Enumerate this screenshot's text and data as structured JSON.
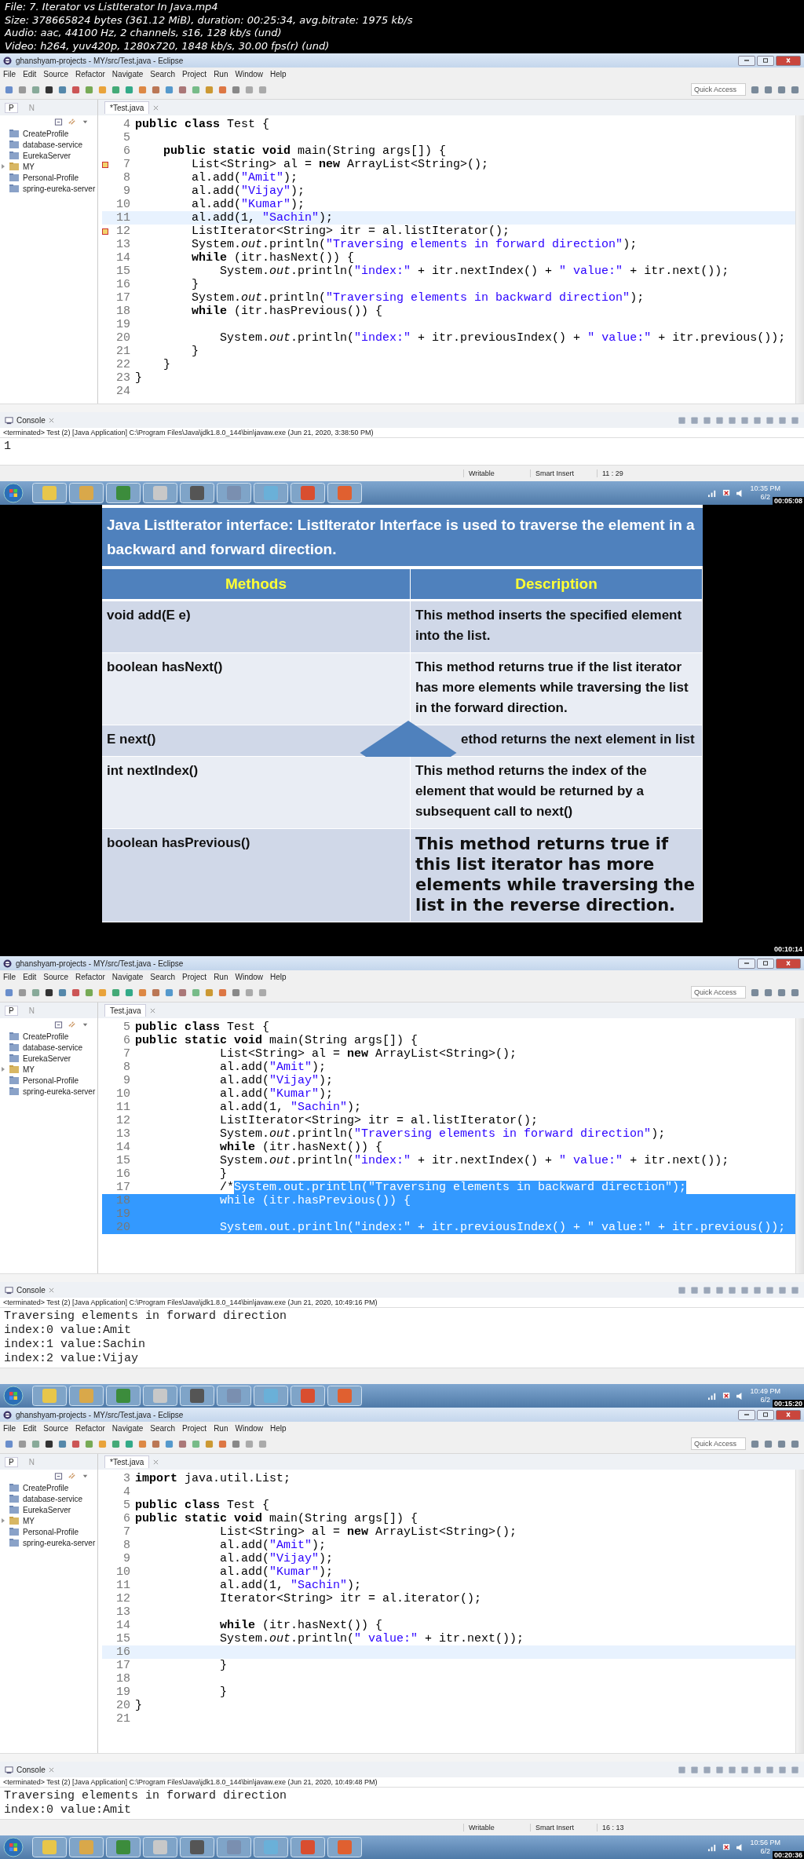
{
  "info": [
    "File: 7. Iterator vs ListIterator In Java.mp4",
    "Size: 378665824 bytes (361.12 MiB), duration: 00:25:34, avg.bitrate: 1975 kb/s",
    "Audio: aac, 44100 Hz, 2 channels, s16, 128 kb/s (und)",
    "Video: h264, yuv420p, 1280x720, 1848 kb/s, 30.00 fps(r) (und)"
  ],
  "frames": [
    {
      "kind": "ide",
      "title": "ghanshyam-projects - MY/src/Test.java - Eclipse",
      "menu": [
        "File",
        "Edit",
        "Source",
        "Refactor",
        "Navigate",
        "Search",
        "Project",
        "Run",
        "Window",
        "Help"
      ],
      "quick_access": "Quick Access",
      "left_tabs": [
        {
          "label": "P",
          "selected": true
        },
        {
          "label": "N",
          "selected": false
        }
      ],
      "tree": [
        {
          "label": "CreateProfile",
          "kind": "folder"
        },
        {
          "label": "database-service",
          "kind": "folder"
        },
        {
          "label": "EurekaServer",
          "kind": "folder"
        },
        {
          "label": "MY",
          "kind": "project"
        },
        {
          "label": "Personal-Profile",
          "kind": "folder"
        },
        {
          "label": "spring-eureka-server",
          "kind": "folder"
        }
      ],
      "editor_tab": "*Test.java",
      "code": [
        {
          "num": "4",
          "kind": "plain",
          "text": "**public** **class** Test {"
        },
        {
          "num": "5",
          "kind": "plain"
        },
        {
          "num": "6",
          "kind": "plain",
          "text": "    **public** **static** **void** main(String args[]) {"
        },
        {
          "num": "7",
          "kind": "marked",
          "text": "        List<String> al = **new** ArrayList<String>();"
        },
        {
          "num": "8",
          "kind": "plain",
          "text": "        al.add(\"Amit\");"
        },
        {
          "num": "9",
          "kind": "plain",
          "text": "        al.add(\"Vijay\");"
        },
        {
          "num": "10",
          "kind": "plain",
          "text": "        al.add(\"Kumar\");"
        },
        {
          "num": "11",
          "kind": "current",
          "text": "        al.add(1, \"Sachin\");"
        },
        {
          "num": "12",
          "kind": "marked",
          "text": "        ListIterator<String> itr = al.listIterator();"
        },
        {
          "num": "13",
          "kind": "plain",
          "text": "        System.*out*.println(\"Traversing elements in forward direction\");"
        },
        {
          "num": "14",
          "kind": "plain",
          "text": "        **while** (itr.hasNext()) {"
        },
        {
          "num": "15",
          "kind": "plain",
          "text": "            System.*out*.println(\"index:\" + itr.nextIndex() + \" value:\" + itr.next());"
        },
        {
          "num": "16",
          "kind": "plain",
          "text": "        }"
        },
        {
          "num": "17",
          "kind": "plain",
          "text": "        System.*out*.println(\"Traversing elements in backward direction\");"
        },
        {
          "num": "18",
          "kind": "plain",
          "text": "        **while** (itr.hasPrevious()) {"
        },
        {
          "num": "19",
          "kind": "plain"
        },
        {
          "num": "20",
          "kind": "plain",
          "text": "            System.*out*.println(\"index:\" + itr.previousIndex() + \" value:\" + itr.previous());"
        },
        {
          "num": "21",
          "kind": "plain",
          "text": "        }"
        },
        {
          "num": "22",
          "kind": "plain",
          "text": "    }"
        },
        {
          "num": "23",
          "kind": "plain",
          "text": "}"
        },
        {
          "num": "24",
          "kind": "plain"
        }
      ],
      "console": {
        "label": "Console",
        "status": "<terminated> Test (2) [Java Application] C:\\Program Files\\Java\\jdk1.8.0_144\\bin\\javaw.exe (Jun 21, 2020, 3:38:50 PM)",
        "output": [
          "1"
        ]
      },
      "status": [
        "Writable",
        "Smart Insert",
        "11 : 29"
      ],
      "taskbar": {
        "clock": "10:35 PM",
        "date": "6/2",
        "timestamp": "00:05:08"
      }
    },
    {
      "kind": "slide",
      "heading": "**Java ListIterator interface**: ListIterator Interface is used to traverse the element in a backward and forward direction.",
      "columns": [
        "Methods",
        "Description"
      ],
      "rows": [
        {
          "method": "void add(E e)",
          "description": "This method inserts the specified element into the list.",
          "kind": "normal"
        },
        {
          "method": "boolean hasNext()",
          "description": "This method returns true if the list iterator has more elements while traversing the list in the forward direction.",
          "kind": "normal"
        },
        {
          "method": "E next()",
          "description": "ethod returns the next element in list",
          "kind": "pointer"
        },
        {
          "method": "int nextIndex()",
          "description": "This method returns the index of the element that would be returned by a subsequent call to next()",
          "kind": "normal"
        },
        {
          "method": "boolean hasPrevious()",
          "description": "This method returns true if this list iterator has more elements while traversing the list in the reverse direction.",
          "kind": "emphasis"
        }
      ],
      "timestamp": "00:10:14"
    },
    {
      "kind": "ide",
      "title": "ghanshyam-projects - MY/src/Test.java - Eclipse",
      "menu": [
        "File",
        "Edit",
        "Source",
        "Refactor",
        "Navigate",
        "Search",
        "Project",
        "Run",
        "Window",
        "Help"
      ],
      "quick_access": "Quick Access",
      "left_tabs": [
        {
          "label": "P",
          "selected": true
        },
        {
          "label": "N",
          "selected": false
        }
      ],
      "tree": [
        {
          "label": "CreateProfile",
          "kind": "folder"
        },
        {
          "label": "database-service",
          "kind": "folder"
        },
        {
          "label": "EurekaServer",
          "kind": "folder"
        },
        {
          "label": "MY",
          "kind": "project"
        },
        {
          "label": "Personal-Profile",
          "kind": "folder"
        },
        {
          "label": "spring-eureka-server",
          "kind": "folder"
        }
      ],
      "editor_tab": "Test.java",
      "code": [
        {
          "num": "5",
          "kind": "plain",
          "text": "**public** **class** Test {"
        },
        {
          "num": "6",
          "kind": "plain",
          "text": "**public** **static** **void** main(String args[]) {"
        },
        {
          "num": "7",
          "kind": "plain",
          "text": "            List<String> al = **new** ArrayList<String>();"
        },
        {
          "num": "8",
          "kind": "plain",
          "text": "            al.add(\"Amit\");"
        },
        {
          "num": "9",
          "kind": "plain",
          "text": "            al.add(\"Vijay\");"
        },
        {
          "num": "10",
          "kind": "plain",
          "text": "            al.add(\"Kumar\");"
        },
        {
          "num": "11",
          "kind": "plain",
          "text": "            al.add(1, \"Sachin\");"
        },
        {
          "num": "12",
          "kind": "plain",
          "text": "            ListIterator<String> itr = al.listIterator();"
        },
        {
          "num": "13",
          "kind": "plain",
          "text": "            System.*out*.println(\"Traversing elements in forward direction\");"
        },
        {
          "num": "14",
          "kind": "plain",
          "text": "            **while** (itr.hasNext()) {"
        },
        {
          "num": "15",
          "kind": "plain",
          "text": "            System.*out*.println(\"index:\" + itr.nextIndex() + \" value:\" + itr.next());"
        },
        {
          "num": "16",
          "kind": "plain",
          "text": "            }"
        },
        {
          "num": "17",
          "kind": "partial",
          "text": "            /*",
          "selected_text": "System.out.println(\"Traversing elements in backward direction\");"
        },
        {
          "num": "18",
          "kind": "selected",
          "text": "            while (itr.hasPrevious()) {"
        },
        {
          "num": "19",
          "kind": "selected"
        },
        {
          "num": "20",
          "kind": "selected",
          "text": "            System.out.println(\"index:\" + itr.previousIndex() + \" value:\" + itr.previous());"
        }
      ],
      "console": {
        "label": "Console",
        "status": "<terminated> Test (2) [Java Application] C:\\Program Files\\Java\\jdk1.8.0_144\\bin\\javaw.exe (Jun 21, 2020, 10:49:16 PM)",
        "output": [
          "Traversing elements in forward direction",
          "index:0 value:Amit",
          "index:1 value:Sachin",
          "index:2 value:Vijay"
        ]
      },
      "taskbar": {
        "clock": "10:49 PM",
        "date": "6/2",
        "timestamp": "00:15:20"
      }
    },
    {
      "kind": "ide",
      "title": "ghanshyam-projects - MY/src/Test.java - Eclipse",
      "menu": [
        "File",
        "Edit",
        "Source",
        "Refactor",
        "Navigate",
        "Search",
        "Project",
        "Run",
        "Window",
        "Help"
      ],
      "quick_access": "Quick Access",
      "left_tabs": [
        {
          "label": "P",
          "selected": true
        },
        {
          "label": "N",
          "selected": false
        }
      ],
      "tree": [
        {
          "label": "CreateProfile",
          "kind": "folder"
        },
        {
          "label": "database-service",
          "kind": "folder"
        },
        {
          "label": "EurekaServer",
          "kind": "folder"
        },
        {
          "label": "MY",
          "kind": "project"
        },
        {
          "label": "Personal-Profile",
          "kind": "folder"
        },
        {
          "label": "spring-eureka-server",
          "kind": "folder"
        }
      ],
      "editor_tab": "*Test.java",
      "code": [
        {
          "num": "3",
          "kind": "plain",
          "text": "**import** java.util.List;"
        },
        {
          "num": "4",
          "kind": "plain"
        },
        {
          "num": "5",
          "kind": "plain",
          "text": "**public** **class** Test {"
        },
        {
          "num": "6",
          "kind": "plain",
          "text": "**public** **static** **void** main(String args[]) {"
        },
        {
          "num": "7",
          "kind": "plain",
          "text": "            List<String> al = **new** ArrayList<String>();"
        },
        {
          "num": "8",
          "kind": "plain",
          "text": "            al.add(\"Amit\");"
        },
        {
          "num": "9",
          "kind": "plain",
          "text": "            al.add(\"Vijay\");"
        },
        {
          "num": "10",
          "kind": "plain",
          "text": "            al.add(\"Kumar\");"
        },
        {
          "num": "11",
          "kind": "plain",
          "text": "            al.add(1, \"Sachin\");"
        },
        {
          "num": "12",
          "kind": "plain",
          "text": "            Iterator<String> itr = al.iterator();"
        },
        {
          "num": "13",
          "kind": "plain"
        },
        {
          "num": "14",
          "kind": "plain",
          "text": "            **while** (itr.hasNext()) {"
        },
        {
          "num": "15",
          "kind": "plain",
          "text": "            System.*out*.println(\" value:\" + itr.next());"
        },
        {
          "num": "16",
          "kind": "current"
        },
        {
          "num": "17",
          "kind": "plain",
          "text": "            }"
        },
        {
          "num": "18",
          "kind": "plain"
        },
        {
          "num": "19",
          "kind": "plain",
          "text": "            }"
        },
        {
          "num": "20",
          "kind": "plain",
          "text": "}"
        },
        {
          "num": "21",
          "kind": "plain"
        }
      ],
      "console": {
        "label": "Console",
        "status": "<terminated> Test (2) [Java Application] C:\\Program Files\\Java\\jdk1.8.0_144\\bin\\javaw.exe (Jun 21, 2020, 10:49:48 PM)",
        "output": [
          "Traversing elements in forward direction",
          "index:0 value:Amit"
        ]
      },
      "status": [
        "Writable",
        "Smart Insert",
        "16 : 13"
      ],
      "taskbar": {
        "clock": "10:56 PM",
        "date": "6/2",
        "timestamp": "00:20:36"
      }
    }
  ]
}
